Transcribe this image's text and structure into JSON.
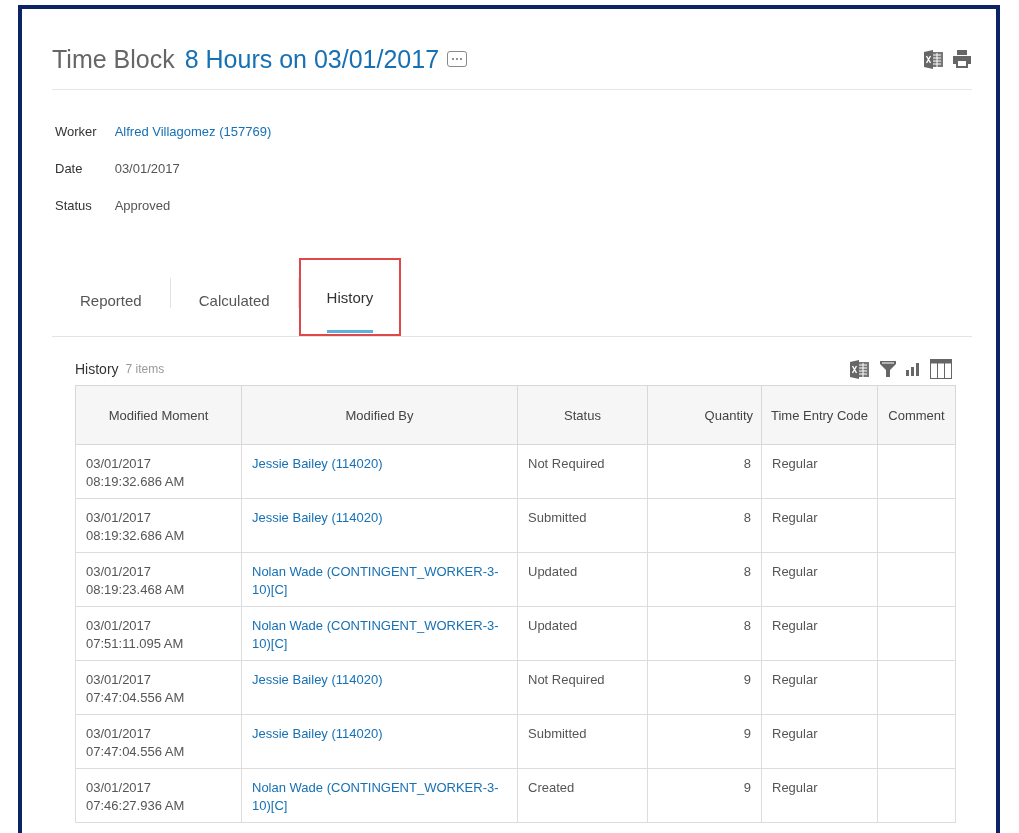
{
  "header": {
    "title_prefix": "Time Block",
    "title": "8 Hours on 03/01/2017",
    "more_button": "⋯"
  },
  "fields": [
    {
      "label": "Worker",
      "value": "Alfred Villagomez (157769)",
      "kind": "link"
    },
    {
      "label": "Date",
      "value": "03/01/2017",
      "kind": "text"
    },
    {
      "label": "Status",
      "value": "Approved",
      "kind": "text"
    }
  ],
  "tabs": [
    {
      "label": "Reported",
      "selected": false,
      "highlighted": false
    },
    {
      "label": "Calculated",
      "selected": false,
      "highlighted": false
    },
    {
      "label": "History",
      "selected": true,
      "highlighted": true
    }
  ],
  "table": {
    "title": "History",
    "count": "7 items",
    "columns": [
      "Modified Moment",
      "Modified By",
      "Status",
      "Quantity",
      "Time Entry Code",
      "Comment"
    ],
    "rows": [
      {
        "date": "03/01/2017",
        "time": "08:19:32.686 AM",
        "modified_by": "Jessie Bailey (114020)",
        "status": "Not Required",
        "quantity": "8",
        "code": "Regular"
      },
      {
        "date": "03/01/2017",
        "time": "08:19:32.686 AM",
        "modified_by": "Jessie Bailey (114020)",
        "status": "Submitted",
        "quantity": "8",
        "code": "Regular"
      },
      {
        "date": "03/01/2017",
        "time": "08:19:23.468 AM",
        "modified_by": "Nolan Wade (CONTINGENT_WORKER-3-10)[C]",
        "status": "Updated",
        "quantity": "8",
        "code": "Regular"
      },
      {
        "date": "03/01/2017",
        "time": "07:51:11.095 AM",
        "modified_by": "Nolan Wade (CONTINGENT_WORKER-3-10)[C]",
        "status": "Updated",
        "quantity": "8",
        "code": "Regular"
      },
      {
        "date": "03/01/2017",
        "time": "07:47:04.556 AM",
        "modified_by": "Jessie Bailey (114020)",
        "status": "Not Required",
        "quantity": "9",
        "code": "Regular"
      },
      {
        "date": "03/01/2017",
        "time": "07:47:04.556 AM",
        "modified_by": "Jessie Bailey (114020)",
        "status": "Submitted",
        "quantity": "9",
        "code": "Regular"
      },
      {
        "date": "03/01/2017",
        "time": "07:46:27.936 AM",
        "modified_by": "Nolan Wade (CONTINGENT_WORKER-3-10)[C]",
        "status": "Created",
        "quantity": "9",
        "code": "Regular"
      }
    ]
  }
}
